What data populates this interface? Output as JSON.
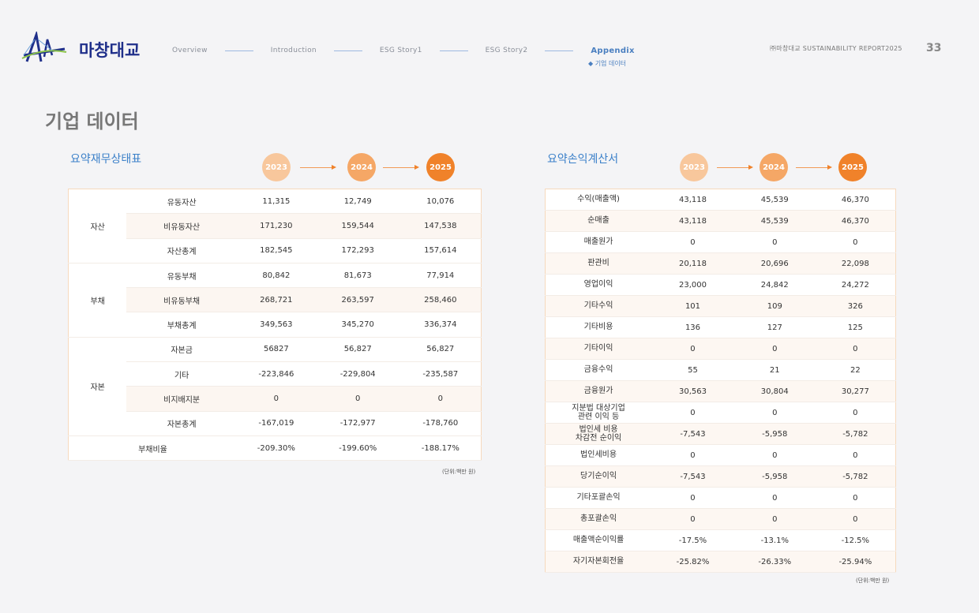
{
  "header": {
    "logo_text": "마창대교",
    "nav": [
      "Overview",
      "Introduction",
      "ESG Story1",
      "ESG Story2",
      "Appendix"
    ],
    "nav_sub": "◆ 기업 데이터",
    "report_label": "㈜마창대교 SUSTAINABILITY REPORT2025",
    "page_number": "33"
  },
  "page_title": "기업 데이터",
  "balance_sheet": {
    "title": "요약재무상태표",
    "years": [
      "2023",
      "2024",
      "2025"
    ],
    "groups": [
      {
        "name": "자산",
        "rows": [
          {
            "label": "유동자산",
            "values": [
              "11,315",
              "12,749",
              "10,076"
            ]
          },
          {
            "label": "비유동자산",
            "values": [
              "171,230",
              "159,544",
              "147,538"
            ]
          },
          {
            "label": "자산총계",
            "values": [
              "182,545",
              "172,293",
              "157,614"
            ]
          }
        ]
      },
      {
        "name": "부채",
        "rows": [
          {
            "label": "유동부채",
            "values": [
              "80,842",
              "81,673",
              "77,914"
            ]
          },
          {
            "label": "비유동부채",
            "values": [
              "268,721",
              "263,597",
              "258,460"
            ]
          },
          {
            "label": "부채총계",
            "values": [
              "349,563",
              "345,270",
              "336,374"
            ]
          }
        ]
      },
      {
        "name": "자본",
        "rows": [
          {
            "label": "자본금",
            "values": [
              "56827",
              "56,827",
              "56,827"
            ]
          },
          {
            "label": "기타",
            "values": [
              "-223,846",
              "-229,804",
              "-235,587"
            ]
          },
          {
            "label": "비지배지분",
            "values": [
              "0",
              "0",
              "0"
            ]
          },
          {
            "label": "자본총계",
            "values": [
              "-167,019",
              "-172,977",
              "-178,760"
            ]
          }
        ]
      }
    ],
    "ratio": {
      "label": "부채비율",
      "values": [
        "-209.30%",
        "-199.60%",
        "-188.17%"
      ]
    },
    "unit": "(단위:백만 원)"
  },
  "income_statement": {
    "title": "요약손익계산서",
    "years": [
      "2023",
      "2024",
      "2025"
    ],
    "rows": [
      {
        "label": "수익(매출액)",
        "values": [
          "43,118",
          "45,539",
          "46,370"
        ]
      },
      {
        "label": "순매출",
        "values": [
          "43,118",
          "45,539",
          "46,370"
        ]
      },
      {
        "label": "매출원가",
        "values": [
          "0",
          "0",
          "0"
        ]
      },
      {
        "label": "판관비",
        "values": [
          "20,118",
          "20,696",
          "22,098"
        ]
      },
      {
        "label": "영업이익",
        "values": [
          "23,000",
          "24,842",
          "24,272"
        ]
      },
      {
        "label": "기타수익",
        "values": [
          "101",
          "109",
          "326"
        ]
      },
      {
        "label": "기타비용",
        "values": [
          "136",
          "127",
          "125"
        ]
      },
      {
        "label": "기타이익",
        "values": [
          "0",
          "0",
          "0"
        ]
      },
      {
        "label": "금융수익",
        "values": [
          "55",
          "21",
          "22"
        ]
      },
      {
        "label": "금융원가",
        "values": [
          "30,563",
          "30,804",
          "30,277"
        ]
      },
      {
        "label": "지분법 대상기업\n관련 이익 등",
        "values": [
          "0",
          "0",
          "0"
        ]
      },
      {
        "label": "법인세 비용\n차감전 순이익",
        "values": [
          "-7,543",
          "-5,958",
          "-5,782"
        ]
      },
      {
        "label": "법인세비용",
        "values": [
          "0",
          "0",
          "0"
        ]
      },
      {
        "label": "당기순이익",
        "values": [
          "-7,543",
          "-5,958",
          "-5,782"
        ]
      },
      {
        "label": "기타포괄손익",
        "values": [
          "0",
          "0",
          "0"
        ]
      },
      {
        "label": "총포괄손익",
        "values": [
          "0",
          "0",
          "0"
        ]
      },
      {
        "label": "매출액순이익률",
        "values": [
          "-17.5%",
          "-13.1%",
          "-12.5%"
        ]
      },
      {
        "label": "자기자본회전율",
        "values": [
          "-25.82%",
          "-26.33%",
          "-25.94%"
        ]
      }
    ],
    "unit": "(단위:백만 원)"
  },
  "colors": {
    "accent_blue": "#3b80c9",
    "brand_navy": "#1f2f8a",
    "orange_dark": "#f0822a",
    "orange_mid": "#f5a766",
    "orange_light": "#f8c79c"
  }
}
